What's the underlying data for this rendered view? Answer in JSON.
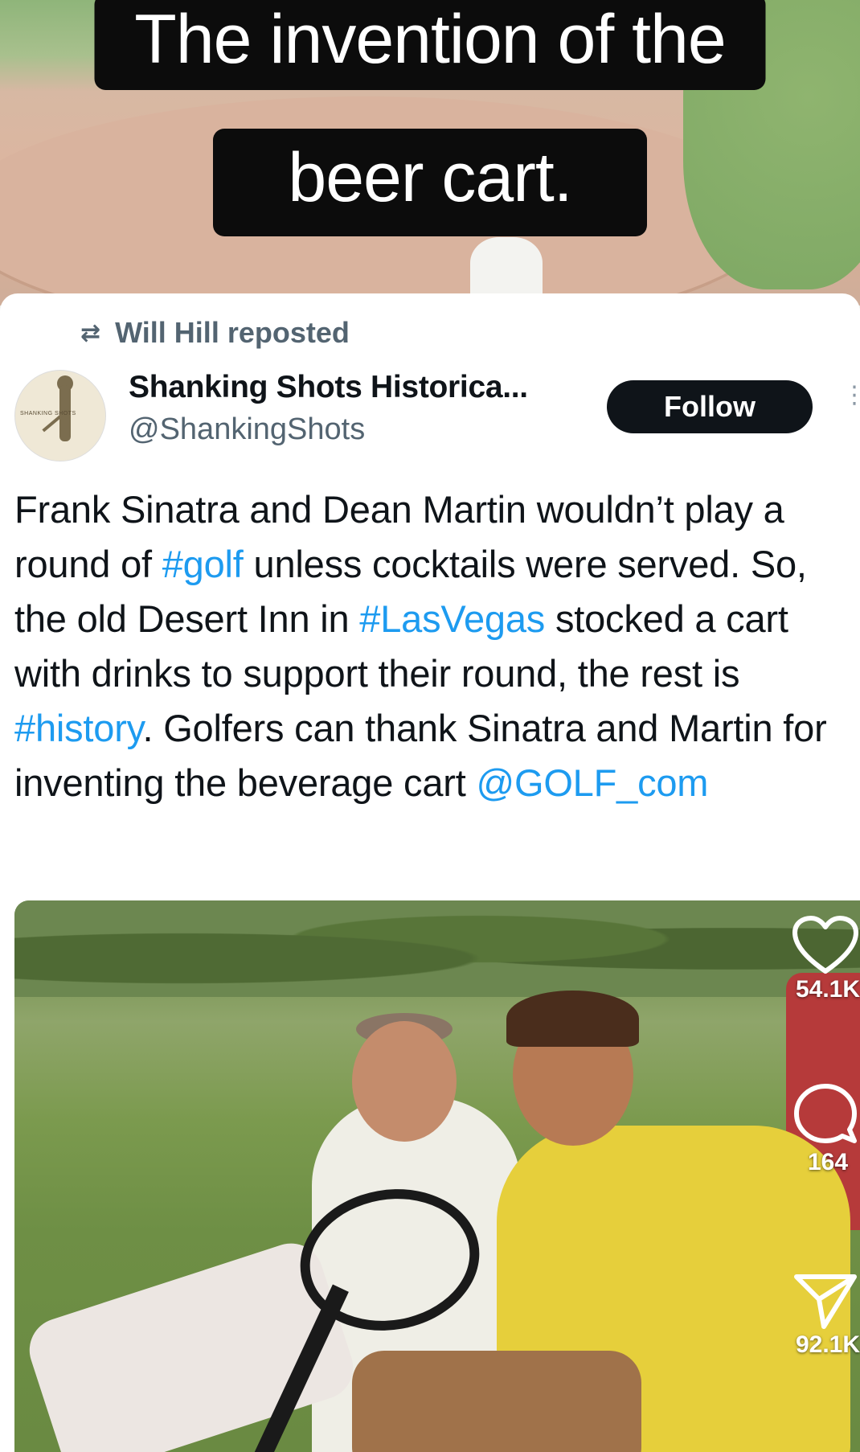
{
  "overlay": {
    "caption_line1": "The invention of the",
    "caption_line2": "beer cart."
  },
  "tweet": {
    "repost_label": "Will Hill reposted",
    "author_name": "Shanking Shots Historica...",
    "author_handle": "@ShankingShots",
    "follow_label": "Follow",
    "avatar_text": "SHANKING SHOTS",
    "text": {
      "p1": "Frank Sinatra and Dean Martin wouldn’t play a round of ",
      "tag1": "#golf",
      "p2": " unless cocktails were served. So, the old Desert Inn in ",
      "tag2": "#LasVegas",
      "p3": " stocked a cart with drinks to support their round, the rest is ",
      "tag3": "#history",
      "p4": ". Golfers can thank Sinatra and Martin for inventing the beverage cart ",
      "mention": "@GOLF_com"
    }
  },
  "actions": {
    "likes": "54.1K",
    "comments": "164",
    "shares": "92.1K"
  },
  "icons": {
    "retweet": "retweet-icon",
    "like": "heart-icon",
    "comment": "comment-icon",
    "share": "send-icon",
    "more": "more-options-icon"
  },
  "colors": {
    "link": "#1d9bf0",
    "text": "#0f1419",
    "muted": "#536471",
    "follow_bg": "#0f1419"
  }
}
